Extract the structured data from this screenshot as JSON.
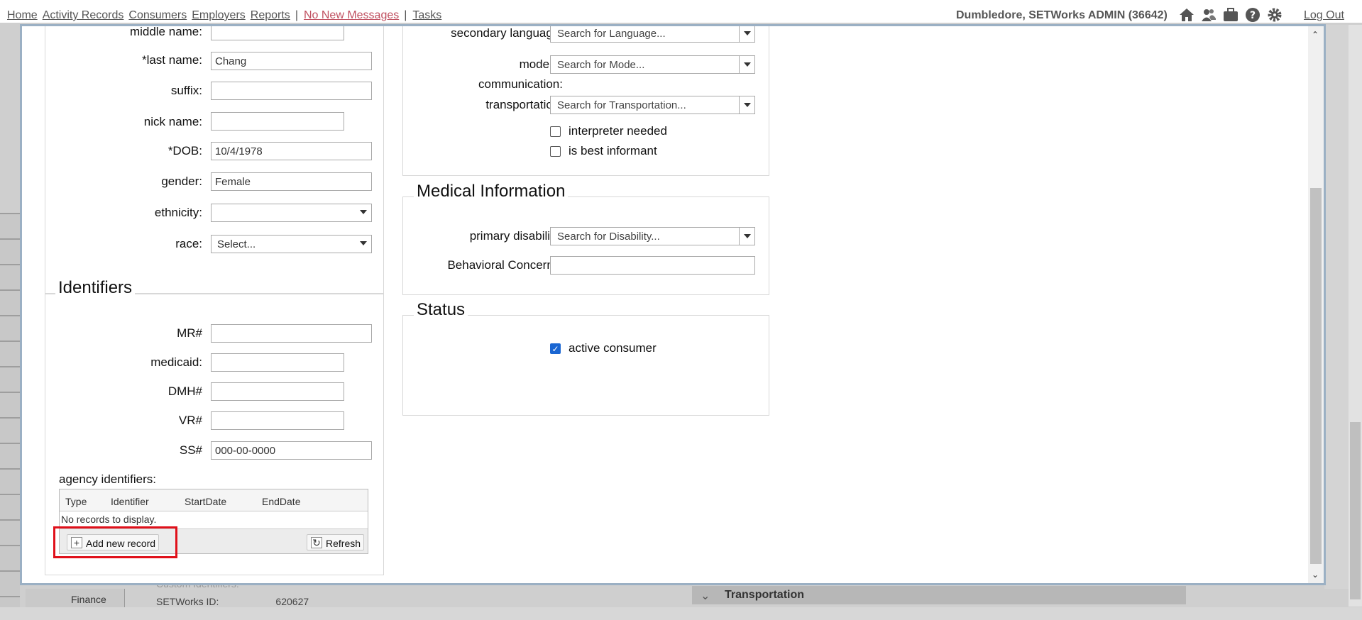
{
  "nav": {
    "links": [
      "Home",
      "Activity Records",
      "Consumers",
      "Employers",
      "Reports"
    ],
    "messages": "No New Messages",
    "tasks": "Tasks",
    "user": "Dumbledore, SETWorks ADMIN (36642)",
    "logout": "Log Out"
  },
  "background": {
    "finance": "Finance",
    "custom_identifiers": "Custom Identifiers:",
    "setworks_id_label": "SETWorks ID:",
    "setworks_id_value": "620627",
    "transportation": "Transportation"
  },
  "personal": {
    "middle_name_label": "middle name:",
    "last_name_label": "*last name:",
    "last_name_value": "Chang",
    "suffix_label": "suffix:",
    "nick_name_label": "nick name:",
    "dob_label": "*DOB:",
    "dob_value": "10/4/1978",
    "gender_label": "gender:",
    "gender_value": "Female",
    "ethnicity_label": "ethnicity:",
    "race_label": "race:",
    "race_value": "Select..."
  },
  "identifiers": {
    "legend": "Identifiers",
    "mr_label": "MR#",
    "medicaid_label": "medicaid:",
    "dmh_label": "DMH#",
    "vr_label": "VR#",
    "ss_label": "SS#",
    "ss_value": "000-00-0000",
    "agency_label": "agency identifiers:",
    "columns": [
      "Type",
      "Identifier",
      "StartDate",
      "EndDate"
    ],
    "no_records": "No records to display.",
    "add_button": "Add new record",
    "refresh_button": "Refresh"
  },
  "communication": {
    "secondary_language_label": "secondary language:",
    "secondary_language_placeholder": "Search for Language...",
    "mode_label_1": "mode of",
    "mode_label_2": "communication:",
    "mode_placeholder": "Search for Mode...",
    "transportation_label": "transportation:",
    "transportation_placeholder": "Search for Transportation...",
    "interpreter_label": "interpreter needed",
    "informant_label": "is best informant"
  },
  "medical": {
    "legend": "Medical Information",
    "primary_disability_label": "primary disability:",
    "primary_disability_placeholder": "Search for Disability...",
    "behavioral_label": "Behavioral Concerns:"
  },
  "status": {
    "legend": "Status",
    "active_label": "active consumer",
    "active_checked": true
  },
  "colors": {
    "highlight": "#e0101a",
    "checkbox_on": "#1a66d2",
    "messages": "#c05060"
  }
}
